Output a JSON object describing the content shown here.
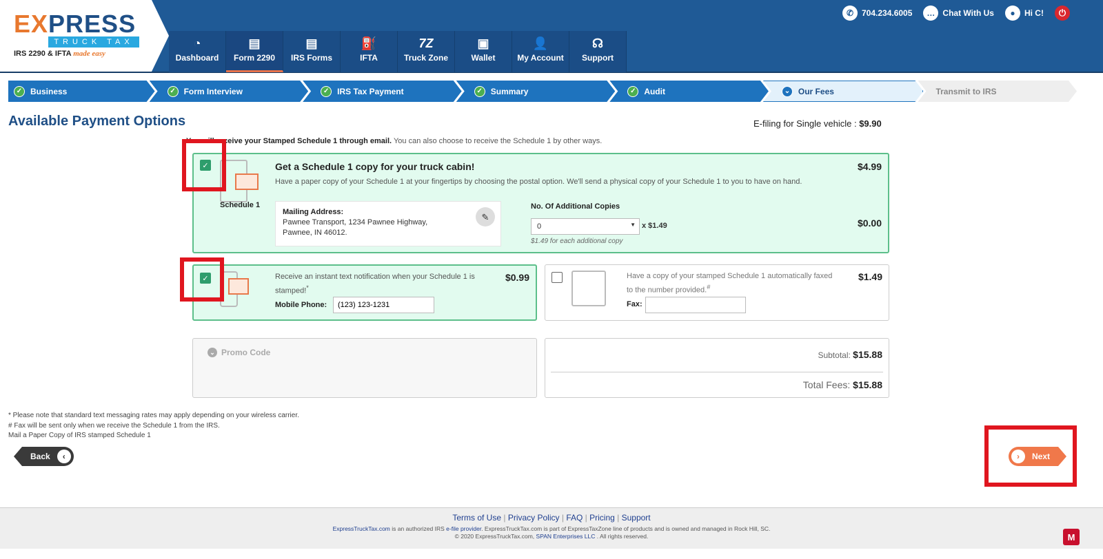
{
  "logo": {
    "main_a": "E",
    "main_b": "X",
    "main_c": "PRESS",
    "sub": "TRUCK TAX",
    "tag": "IRS 2290 & IFTA",
    "tag_script": "made easy"
  },
  "topbar": {
    "phone": "704.234.6005",
    "chat": "Chat With Us",
    "greeting": "Hi C!"
  },
  "nav": [
    {
      "label": "Dashboard",
      "icon": "◔"
    },
    {
      "label": "Form 2290",
      "icon": "▤"
    },
    {
      "label": "IRS Forms",
      "icon": "▤"
    },
    {
      "label": "IFTA",
      "icon": "⛽"
    },
    {
      "label": "Truck Zone",
      "icon": "7Z"
    },
    {
      "label": "Wallet",
      "icon": "▣"
    },
    {
      "label": "My Account",
      "icon": "👤"
    },
    {
      "label": "Support",
      "icon": "☊"
    }
  ],
  "steps": [
    {
      "label": "Business"
    },
    {
      "label": "Form Interview"
    },
    {
      "label": "IRS Tax Payment"
    },
    {
      "label": "Summary"
    },
    {
      "label": "Audit"
    },
    {
      "label": "Our Fees"
    },
    {
      "label": "Transmit to IRS"
    }
  ],
  "page": {
    "title": "Available Payment Options",
    "efile_label": "E-filing for Single vehicle :",
    "efile_price": "$9.90",
    "intro_bold": "You will receive your Stamped Schedule 1 through email.",
    "intro_rest": " You can also choose to receive the Schedule 1 by other ways."
  },
  "schedule_copy": {
    "title": "Get a Schedule 1 copy for your truck cabin!",
    "desc": "Have a paper copy of your Schedule 1 at your fingertips by choosing the postal option. We'll send a physical copy of your Schedule 1 to you to have on hand.",
    "icon_label": "Schedule 1",
    "price": "$4.99",
    "address_label": "Mailing Address:",
    "address_line1": "Pawnee Transport, 1234 Pawnee Highway,",
    "address_line2": "Pawnee, IN 46012.",
    "copies_label": "No. Of Additional Copies",
    "copies_value": "0",
    "copies_mult": "x $1.49",
    "copies_note": "$1.49 for each additional copy",
    "copies_total": "$0.00"
  },
  "text_notify": {
    "desc": "Receive an instant text notification when your Schedule 1 is stamped!",
    "sup": "*",
    "price": "$0.99",
    "phone_label": "Mobile Phone:",
    "phone_value": "(123) 123-1231"
  },
  "fax": {
    "desc": "Have a copy of your stamped Schedule 1 automatically faxed to the number provided.",
    "sup": "#",
    "price": "$1.49",
    "fax_label": "Fax:",
    "fax_value": ""
  },
  "promo": {
    "label": "Promo Code"
  },
  "totals": {
    "subtotal_label": "Subtotal:",
    "subtotal": "$15.88",
    "total_label": "Total Fees:",
    "total": "$15.88"
  },
  "notes": [
    "* Please note that standard text messaging rates may apply depending on your wireless carrier.",
    "# Fax will be sent only when we receive the Schedule 1 from the IRS.",
    "Mail a Paper Copy of IRS stamped Schedule 1"
  ],
  "buttons": {
    "back": "Back",
    "next": "Next"
  },
  "footer": {
    "links": [
      "Terms of Use",
      "Privacy Policy",
      "FAQ",
      "Pricing",
      "Support"
    ],
    "line1_link": "ExpressTruckTax.com",
    "line1_a": " is an authorized IRS ",
    "line1_link2": "e-file provider",
    "line1_b": ". ExpressTruckTax.com is part of ExpressTaxZone line of products and is owned and managed in Rock Hill, SC.",
    "line2_a": "© 2020 ExpressTruckTax.com, ",
    "line2_link": "SPAN Enterprises LLC",
    "line2_b": " . All rights reserved."
  }
}
